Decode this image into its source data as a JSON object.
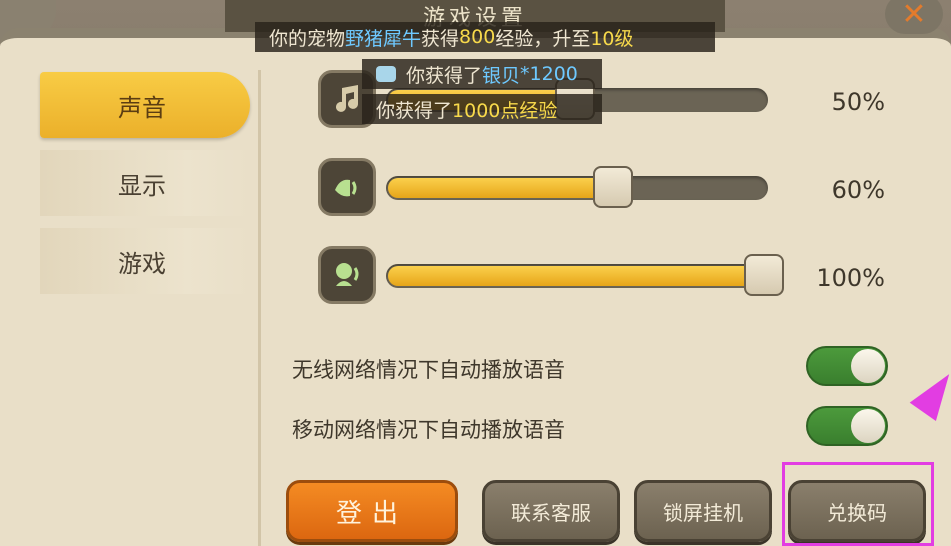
{
  "header": {
    "title": "游戏设置"
  },
  "sidebar": {
    "tabs": [
      {
        "label": "声音",
        "active": true
      },
      {
        "label": "显示",
        "active": false
      },
      {
        "label": "游戏",
        "active": false
      }
    ]
  },
  "sliders": [
    {
      "icon": "music-note-icon",
      "value_percent": 50,
      "label": "50%"
    },
    {
      "icon": "sound-effect-icon",
      "value_percent": 60,
      "label": "60%"
    },
    {
      "icon": "voice-icon",
      "value_percent": 100,
      "label": "100%"
    }
  ],
  "toggles": [
    {
      "label": "无线网络情况下自动播放语音",
      "on": true
    },
    {
      "label": "移动网络情况下自动播放语音",
      "on": true
    }
  ],
  "buttons": {
    "logout": "登出",
    "customer_service": "联系客服",
    "lock_screen": "锁屏挂机",
    "redeem_code": "兑换码"
  },
  "notifications": {
    "n1": {
      "prefix": "你的宠物",
      "pet": "野猪犀牛",
      "mid": "获得",
      "exp": "800",
      "mid2": "经验，升至",
      "level": "10级"
    },
    "n2": {
      "prefix": "你获得了",
      "item": "银贝",
      "count": "*1200"
    },
    "n3": {
      "prefix": "你获得了",
      "exp": "1000点经验"
    }
  },
  "colors": {
    "panel_bg": "#e9dfc8",
    "accent_yellow": "#f0b830",
    "logout_orange": "#ea7a1a",
    "toggle_green": "#46923a",
    "highlight_magenta": "#e23de2"
  }
}
